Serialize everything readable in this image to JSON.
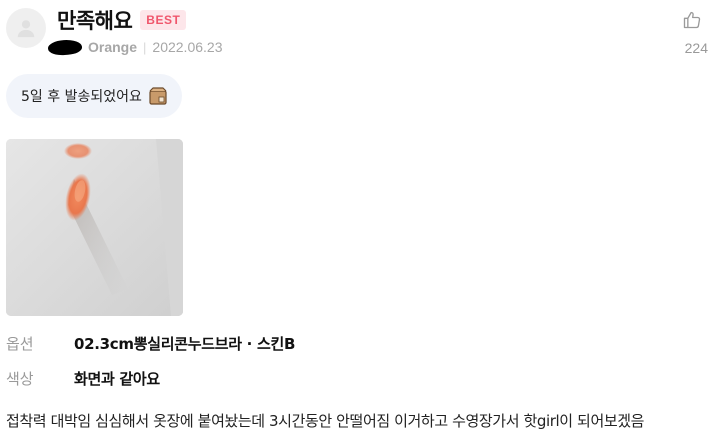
{
  "review": {
    "title": "만족해요",
    "badge": "BEST",
    "user_tier": "Orange",
    "meta_separator": "|",
    "date": "2022.06.23",
    "like_count": "224",
    "shipping_note": "5일 후 발송되었어요",
    "options": [
      {
        "label": "옵션",
        "value": "02.3cm뽕실리콘누드브라 · 스킨B"
      },
      {
        "label": "색상",
        "value": "화면과 같아요"
      }
    ],
    "text": "접착력 대박임 심심해서 옷장에 붙여놨는데 3시간동안 안떨어짐 이거하고 수영장가서 핫girl이 되어보겠음"
  },
  "icons": {
    "avatar": "user-silhouette-icon",
    "like": "thumbs-up-icon",
    "shipping": "box-icon"
  },
  "colors": {
    "badge_bg": "#fde6ea",
    "badge_text": "#f0566c",
    "chip_bg": "#f1f4fa",
    "muted_text": "#9a9a9a"
  }
}
